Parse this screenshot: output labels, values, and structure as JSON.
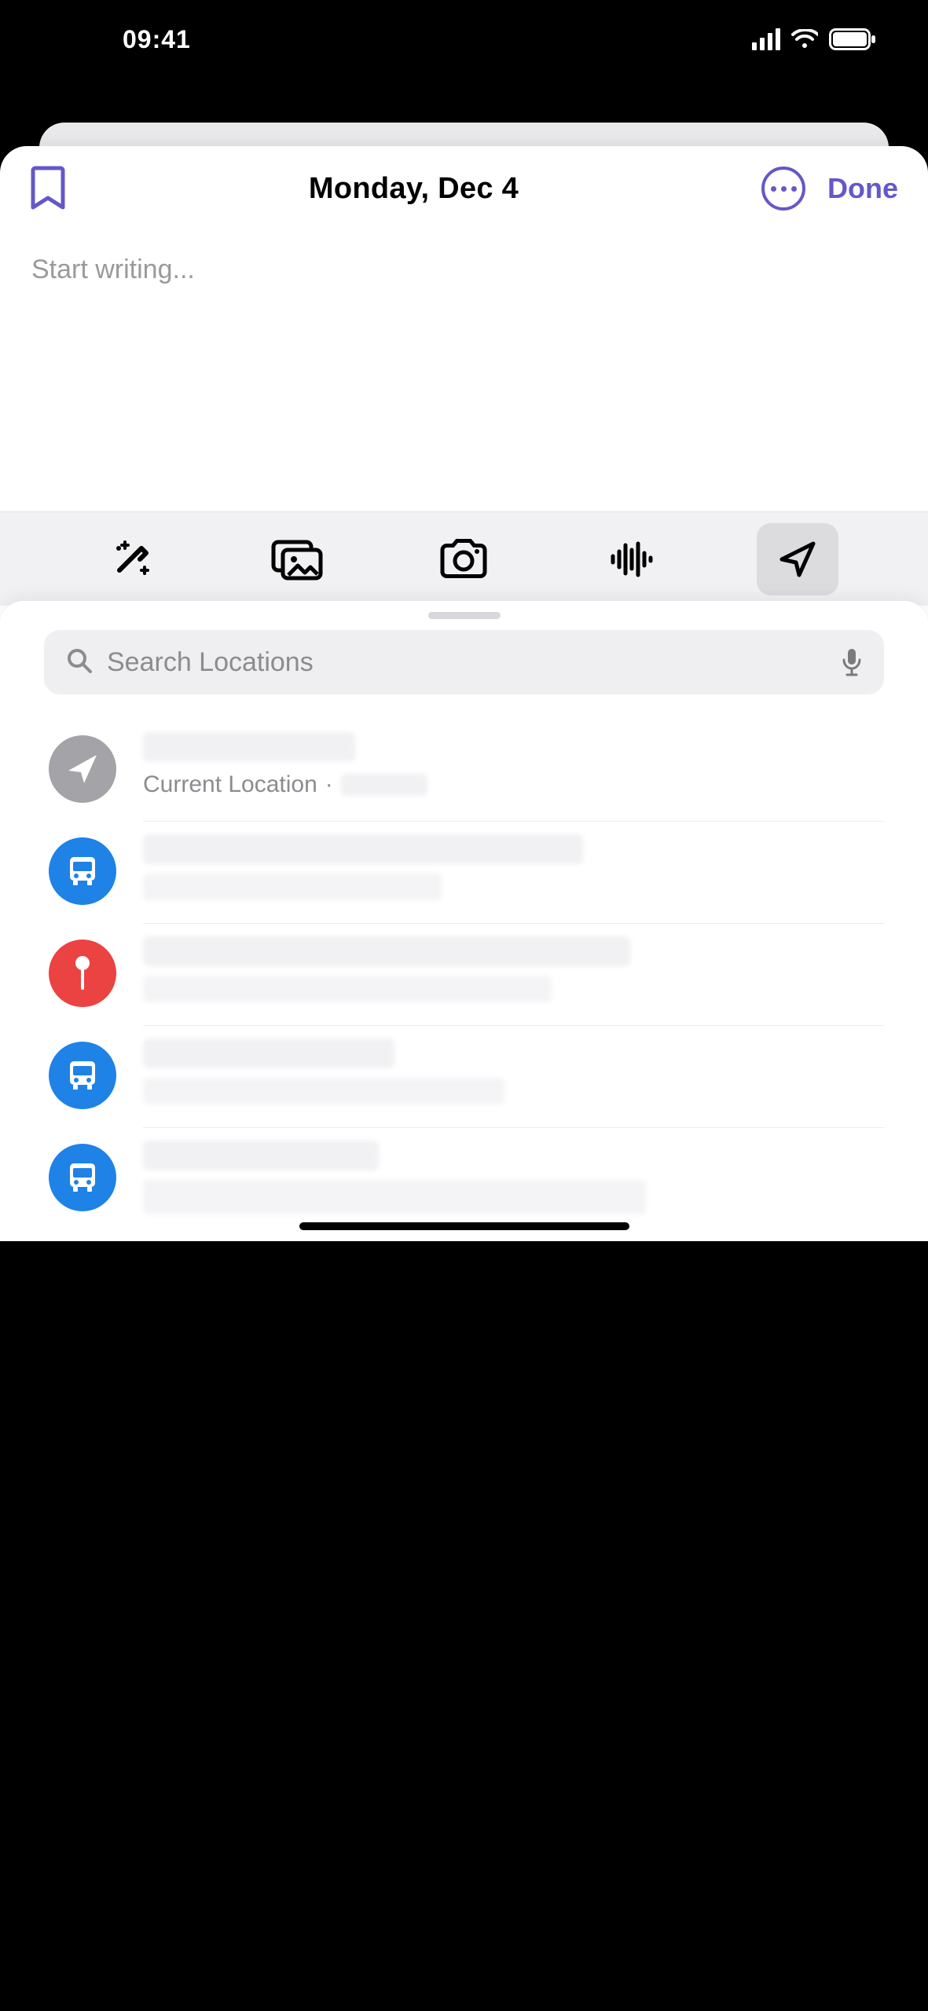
{
  "status": {
    "time": "09:41"
  },
  "nav": {
    "title": "Monday, Dec 4",
    "done_label": "Done"
  },
  "editor": {
    "placeholder": "Start writing..."
  },
  "toolbar": {
    "items": [
      {
        "name": "magic-wand",
        "active": false
      },
      {
        "name": "gallery",
        "active": false
      },
      {
        "name": "camera",
        "active": false
      },
      {
        "name": "waveform",
        "active": false
      },
      {
        "name": "location",
        "active": true
      }
    ]
  },
  "search": {
    "placeholder": "Search Locations"
  },
  "locations": {
    "current_label": "Current Location",
    "separator": "·",
    "items": [
      {
        "type": "current",
        "icon": "location-arrow",
        "icon_bg": "gray"
      },
      {
        "type": "place",
        "icon": "bus",
        "icon_bg": "blue"
      },
      {
        "type": "place",
        "icon": "pin",
        "icon_bg": "red"
      },
      {
        "type": "place",
        "icon": "bus",
        "icon_bg": "blue"
      },
      {
        "type": "place",
        "icon": "bus",
        "icon_bg": "blue"
      }
    ]
  },
  "colors": {
    "accent": "#6458c8",
    "blue": "#1f82e6",
    "red": "#eb4242",
    "gray": "#a3a3a8"
  }
}
